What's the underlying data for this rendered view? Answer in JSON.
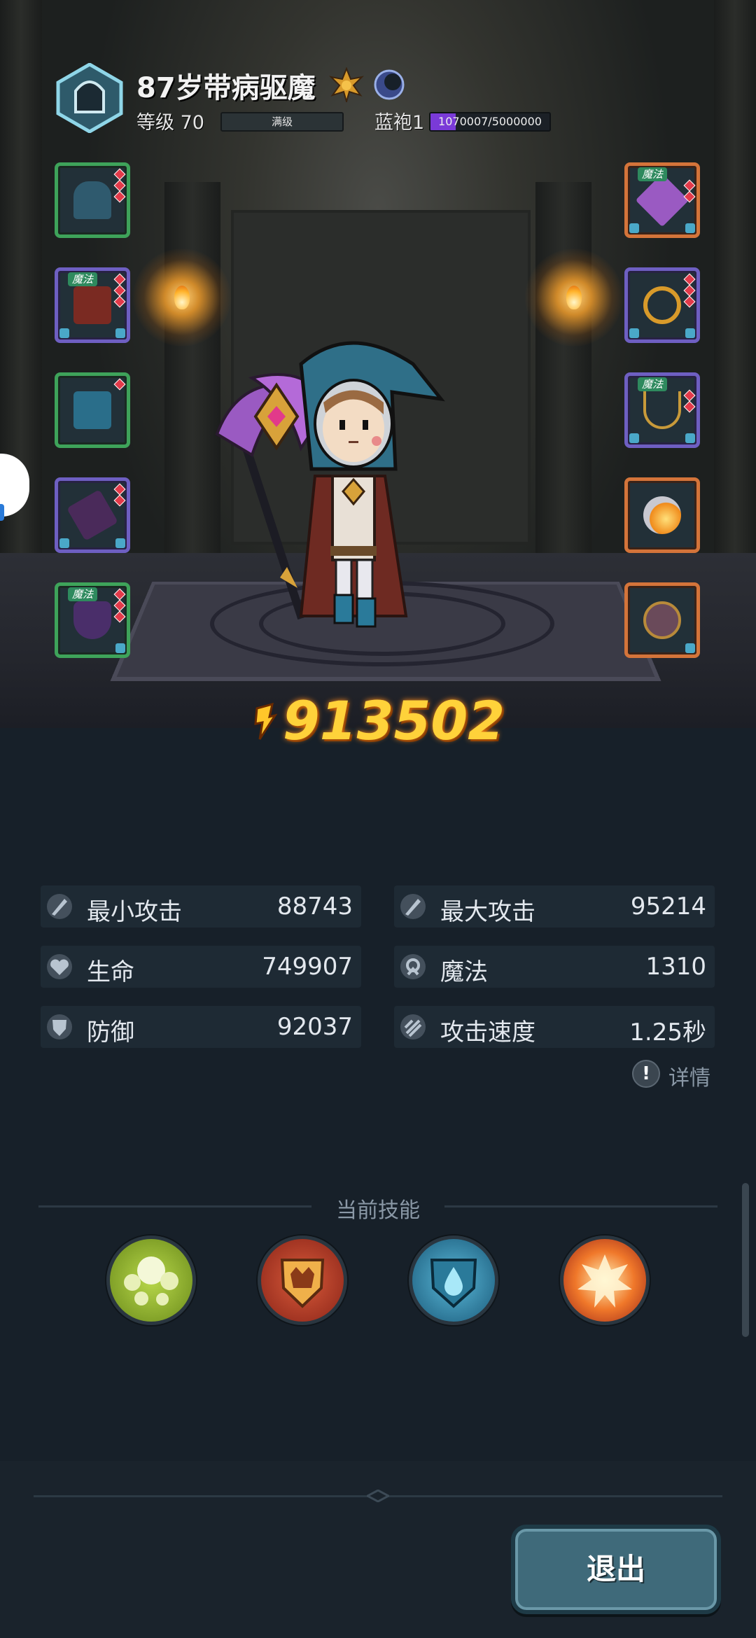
{
  "player": {
    "name": "87岁带病驱魔",
    "level_label": "等级 70",
    "level_bar_label": "满级",
    "rank_label": "蓝袍1",
    "rank_progress_text": "1070007/5000000",
    "rank_progress_fraction": 0.214
  },
  "equipment": {
    "tag_magic": "魔法",
    "left_slots": [
      {
        "item": "hood-icon",
        "rarity": "green"
      },
      {
        "item": "robe-icon",
        "rarity": "purple",
        "tag": "魔法"
      },
      {
        "item": "leggings-icon",
        "rarity": "green"
      },
      {
        "item": "gloves-icon",
        "rarity": "purple"
      },
      {
        "item": "cloak-icon",
        "rarity": "green",
        "tag": "魔法"
      }
    ],
    "right_slots": [
      {
        "item": "staff-icon",
        "rarity": "orange",
        "tag": "魔法"
      },
      {
        "item": "ring-icon",
        "rarity": "purple"
      },
      {
        "item": "necklace-icon",
        "rarity": "purple",
        "tag": "魔法"
      },
      {
        "item": "fire-skill-icon",
        "rarity": "orange"
      },
      {
        "item": "pet-icon",
        "rarity": "orange"
      }
    ]
  },
  "power": {
    "value": "913502"
  },
  "stats": [
    {
      "label": "最小攻击",
      "value": "88743",
      "icon": "sword-icon"
    },
    {
      "label": "最大攻击",
      "value": "95214",
      "icon": "sword-icon"
    },
    {
      "label": "生命",
      "value": "749907",
      "icon": "heart-icon"
    },
    {
      "label": "魔法",
      "value": "1310",
      "icon": "magic-icon"
    },
    {
      "label": "防御",
      "value": "92037",
      "icon": "shield-icon"
    },
    {
      "label": "攻击速度",
      "value": "1.25秒",
      "icon": "speed-icon"
    }
  ],
  "details": {
    "icon_text": "!",
    "label": "详情"
  },
  "skills": {
    "title": "当前技能",
    "items": [
      {
        "icon": "poison-orb-skill-icon",
        "color": "#8cb83a"
      },
      {
        "icon": "crown-shield-skill-icon",
        "color": "#b5422e"
      },
      {
        "icon": "water-shield-skill-icon",
        "color": "#2e8ab0"
      },
      {
        "icon": "explosion-skill-icon",
        "color": "#e85a2a"
      }
    ]
  },
  "exit_button": {
    "label": "退出"
  },
  "colors": {
    "power_gold": "#ffd23a",
    "rank_bar_purple": "#7a3ad8",
    "exit_button": "#3f6a7a"
  }
}
